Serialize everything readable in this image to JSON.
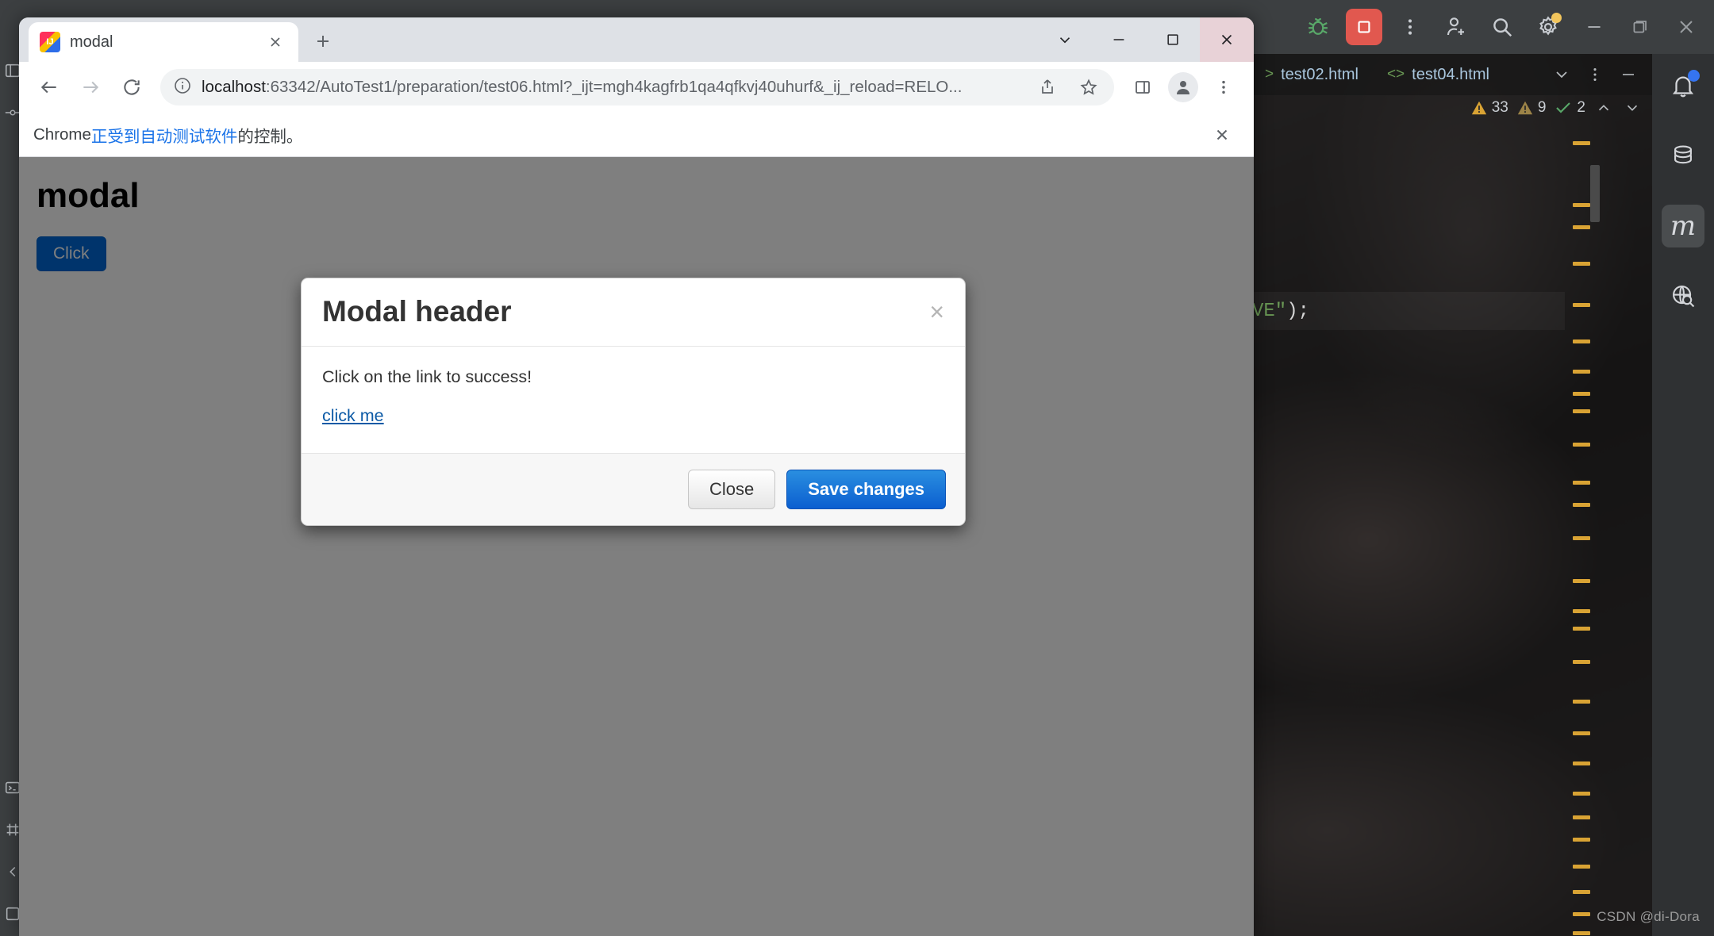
{
  "ide": {
    "toolbar_icons": [
      {
        "name": "debug-icon",
        "glyph": "bug"
      },
      {
        "name": "stop-run-button",
        "glyph": "stop"
      },
      {
        "name": "more-options-icon",
        "glyph": "kebab"
      },
      {
        "name": "add-collaborator-icon",
        "glyph": "person-plus"
      },
      {
        "name": "search-everywhere-icon",
        "glyph": "magnifier"
      },
      {
        "name": "settings-icon",
        "glyph": "gear"
      },
      {
        "name": "minimize-window-button",
        "glyph": "minimize"
      },
      {
        "name": "restore-window-button",
        "glyph": "restore"
      },
      {
        "name": "close-window-button",
        "glyph": "close"
      }
    ],
    "tabs": [
      {
        "label": "test02.html",
        "icon": "html-tag-icon"
      },
      {
        "label": "test04.html",
        "icon": "html-tag-icon"
      }
    ],
    "inspections": {
      "errors_label": "33",
      "warnings_label": "9",
      "checks_label": "2"
    },
    "code_fragment": {
      "string_tail": "VE\"",
      "punctuation": ");"
    },
    "right_sidebar": [
      {
        "name": "notifications-icon",
        "label": "Notifications"
      },
      {
        "name": "database-icon",
        "label": "Database"
      },
      {
        "name": "maven-icon",
        "label": "m"
      },
      {
        "name": "web-search-icon",
        "label": "Endpoints"
      }
    ],
    "watermark": "CSDN @di-Dora",
    "accent_marker_color": "#d9a334",
    "accent_selection_color": "#3574f0"
  },
  "browser": {
    "tab": {
      "title": "modal",
      "favicon": "intellij-idea-icon",
      "close_label": "×"
    },
    "new_tab_label": "+",
    "window_controls": {
      "tab_search_label": "⌄",
      "minimize_label": "−",
      "maximize_label": "□",
      "close_label": "×"
    },
    "nav": {
      "back_label": "←",
      "forward_label": "→",
      "reload_label": "↻"
    },
    "omnibox": {
      "site_info_icon": "info-circle-icon",
      "url_host": "localhost",
      "url_rest": ":63342/AutoTest1/preparation/test06.html?_ijt=mgh4kagfrb1qa4qfkvj40uhurf&_ij_reload=RELO...",
      "url_full": "localhost:63342/AutoTest1/preparation/test06.html?_ijt=mgh4kagfrb1qa4qfkvj40uhurf&_ij_reload=RELO...",
      "share_icon": "share-icon",
      "bookmark_icon": "star-icon",
      "side_panel_icon": "side-panel-icon",
      "profile_icon": "profile-avatar-icon",
      "menu_icon": "kebab-menu-icon"
    },
    "infobar": {
      "prefix": "Chrome ",
      "link_text": "正受到自动测试软件",
      "suffix": "的控制。",
      "close_label": "×"
    }
  },
  "page": {
    "heading": "modal",
    "trigger_button": "Click"
  },
  "modal": {
    "title": "Modal header",
    "close_label": "×",
    "body_text": "Click on the link to success!",
    "link_text": "click me",
    "close_button": "Close",
    "save_button": "Save changes",
    "primary_color": "#0b5fd0"
  }
}
